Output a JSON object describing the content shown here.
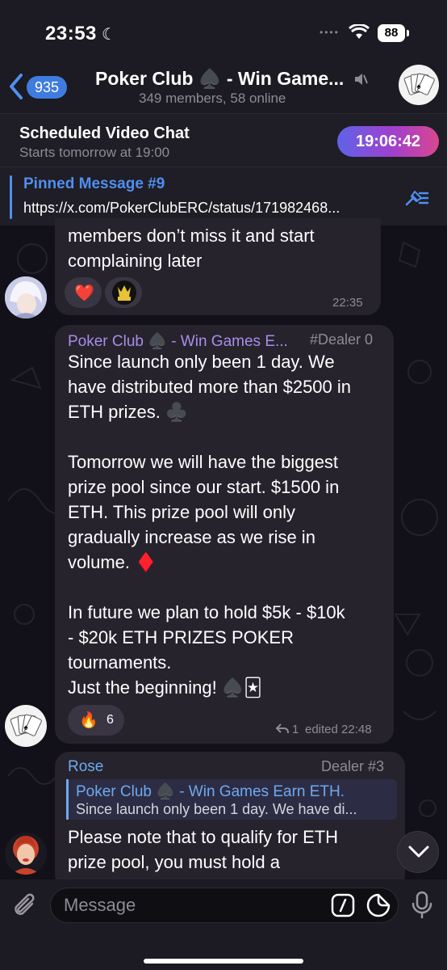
{
  "status_bar": {
    "time": "23:53",
    "battery": "88"
  },
  "header": {
    "unread_count": "935",
    "title": "Poker Club ♠️ - Win Game...",
    "subtitle": "349 members, 58 online"
  },
  "video_chat": {
    "title": "Scheduled Video Chat",
    "subtitle": "Starts tomorrow at 19:00",
    "countdown": "19:06:42"
  },
  "pinned": {
    "title": "Pinned Message #9",
    "text": "https://x.com/PokerClubERC/status/171982468..."
  },
  "messages": [
    {
      "text": "members don’t miss it and start\ncomplaining later",
      "reactions": [
        {
          "emoji": "❤️"
        },
        {
          "emoji": "sticker"
        }
      ],
      "time": "22:35"
    },
    {
      "sender": "Poker Club ♠️ - Win Games E...",
      "tag": "#Dealer 0",
      "text": "Since launch only been 1 day. We\nhave distributed more than $2500 in\nETH prizes. ♣️\n\nTomorrow we will have the biggest\nprize pool since our start. $1500 in\nETH. This prize pool will only\ngradually increase as we rise in\nvolume. ♦️\n\nIn future we plan to hold $5k - $10k\n- $20k ETH PRIZES POKER\ntournaments.\nJust the beginning! ♠️🃏",
      "reaction": {
        "emoji": "🔥",
        "count": "6"
      },
      "replies": "1",
      "edited": "edited 22:48"
    },
    {
      "sender": "Rose",
      "tag": "Dealer #3",
      "reply_title": "Poker Club ♠️ - Win Games Earn ETH.",
      "reply_text": "Since launch only been 1 day. We have di...",
      "text": "Please note that to qualify for ETH\nprize pool, you must hold a"
    }
  ],
  "input": {
    "placeholder": "Message"
  },
  "colors": {
    "accent": "#4f8ff0",
    "bubble": "#26232d",
    "sender_purple": "#a98de8",
    "rose_blue": "#6fa9f0"
  }
}
